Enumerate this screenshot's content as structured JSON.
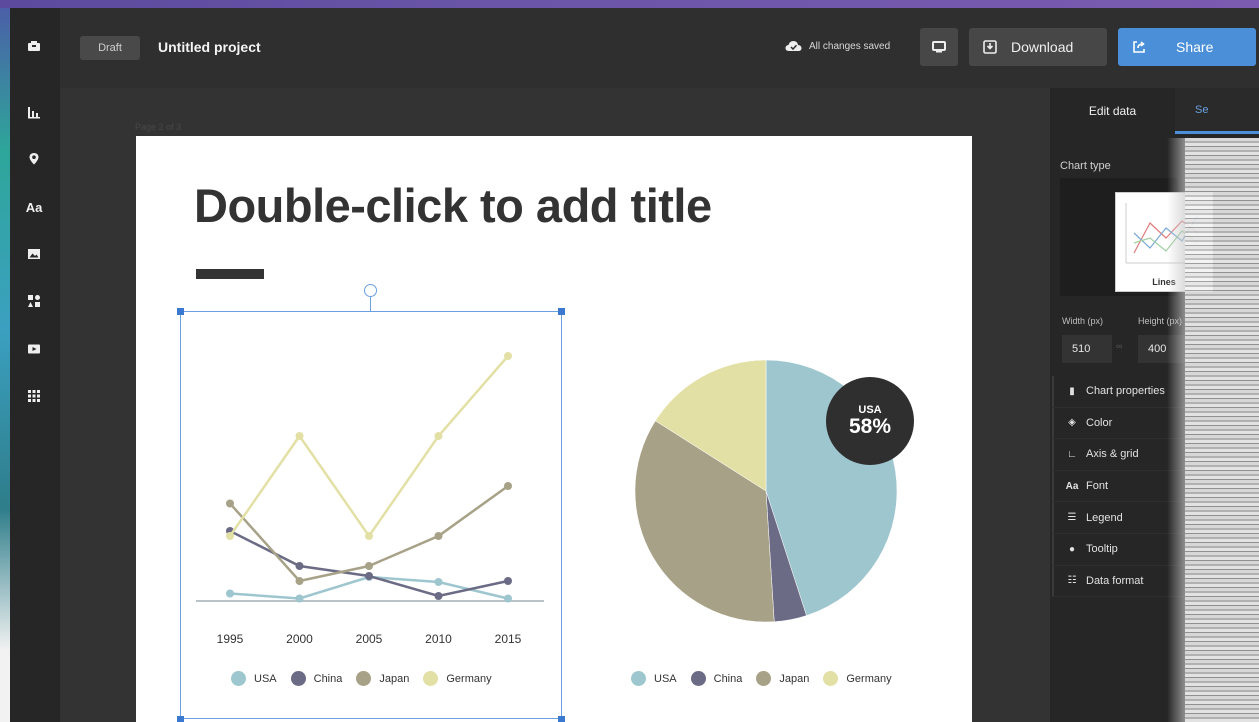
{
  "topbar": {
    "draft_label": "Draft",
    "project_title": "Untitled project",
    "save_status": "All changes saved",
    "download_label": "Download",
    "share_label": "Share"
  },
  "rail": {
    "items": [
      "chart-icon",
      "map-icon",
      "text-icon",
      "image-icon",
      "shapes-icon",
      "video-icon",
      "grid-icon"
    ],
    "text_item_label": "Aa"
  },
  "canvas": {
    "page_indicator": "Page 2 of 3",
    "slide_title": "Double-click to add title"
  },
  "pie_badge": {
    "country": "USA",
    "percent": "58%"
  },
  "panel": {
    "tab_edit": "Edit data",
    "tab_second": "Se",
    "chart_type_label": "Chart type",
    "chart_type_selected": "Lines",
    "width_label": "Width (px)",
    "height_label": "Height (px)",
    "width_value": "510",
    "height_value": "400",
    "properties": [
      {
        "label": "Chart properties",
        "icon": "bar-chart-icon"
      },
      {
        "label": "Color",
        "icon": "paint-bucket-icon"
      },
      {
        "label": "Axis & grid",
        "icon": "axis-icon"
      },
      {
        "label": "Font",
        "icon": "font-icon"
      },
      {
        "label": "Legend",
        "icon": "legend-icon"
      },
      {
        "label": "Tooltip",
        "icon": "speech-bubble-icon"
      },
      {
        "label": "Data format",
        "icon": "list-icon"
      }
    ]
  },
  "colors": {
    "accent": "#4a8fd8",
    "usa": "#9ec6cf",
    "china": "#6b6b85",
    "japan": "#a7a187",
    "germany": "#e3e0a6"
  },
  "chart_data": [
    {
      "type": "line",
      "x": [
        "1995",
        "2000",
        "2005",
        "2010",
        "2015"
      ],
      "series": [
        {
          "name": "USA",
          "values": [
            1.5,
            0.5,
            4.8,
            3.8,
            0.5
          ]
        },
        {
          "name": "China",
          "values": [
            14,
            7,
            5,
            1,
            4
          ]
        },
        {
          "name": "Japan",
          "values": [
            19.5,
            4,
            7,
            13,
            23
          ]
        },
        {
          "name": "Germany",
          "values": [
            13,
            33,
            13,
            33,
            49
          ]
        }
      ],
      "ylim": [
        0,
        52
      ],
      "grid": false,
      "legend": "bottom"
    },
    {
      "type": "pie",
      "categories": [
        "USA",
        "China",
        "Japan",
        "Germany"
      ],
      "values": [
        45,
        4,
        35,
        16
      ],
      "legend": "bottom"
    }
  ]
}
